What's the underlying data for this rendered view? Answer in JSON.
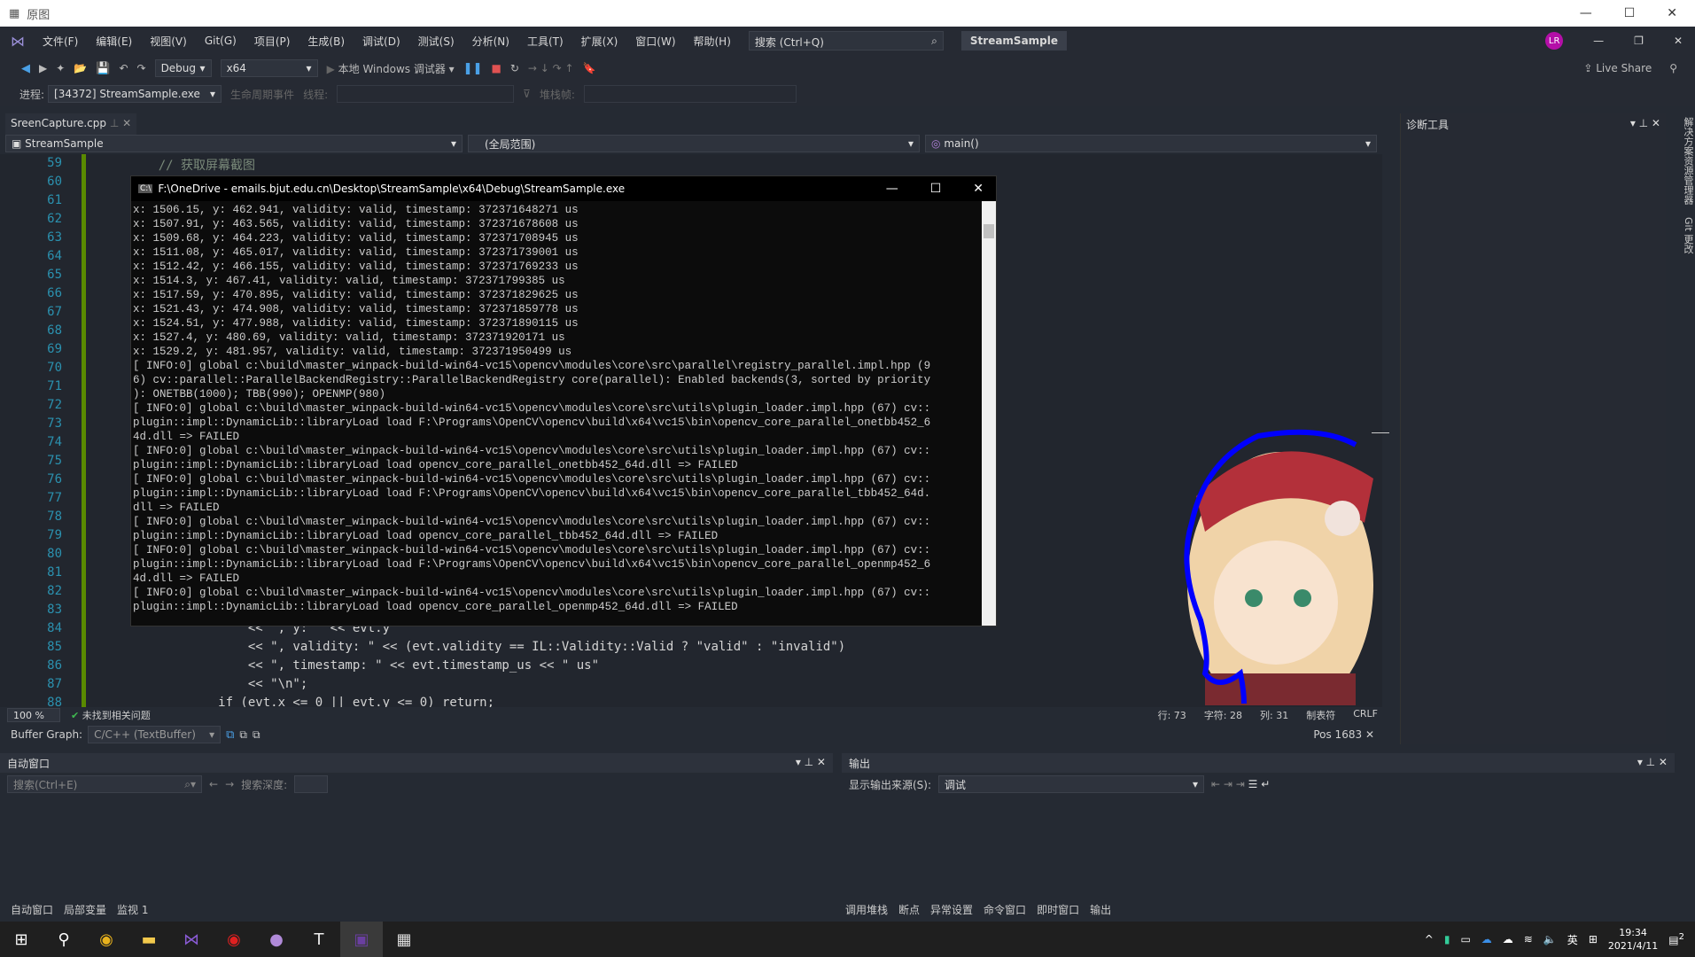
{
  "outer_window": {
    "title": "原图"
  },
  "menu": {
    "items": [
      "文件(F)",
      "编辑(E)",
      "视图(V)",
      "Git(G)",
      "项目(P)",
      "生成(B)",
      "调试(D)",
      "测试(S)",
      "分析(N)",
      "工具(T)",
      "扩展(X)",
      "窗口(W)",
      "帮助(H)"
    ],
    "search_placeholder": "搜索 (Ctrl+Q)",
    "solution": "StreamSample",
    "avatar": "LR"
  },
  "toolbar": {
    "config": "Debug",
    "platform": "x64",
    "debugger": "本地 Windows 调试器",
    "live_share": "Live Share"
  },
  "toolbar2": {
    "process_label": "进程:",
    "process": "[34372] StreamSample.exe",
    "lifecycle": "生命周期事件",
    "thread_label": "线程:",
    "stack_label": "堆栈帧:"
  },
  "editor": {
    "tab": "SreenCapture.cpp",
    "nav_project": "StreamSample",
    "nav_scope": "(全局范围)",
    "nav_func": "main()",
    "line_numbers": [
      "59",
      "60",
      "61",
      "62",
      "63",
      "64",
      "65",
      "66",
      "67",
      "68",
      "69",
      "70",
      "71",
      "72",
      "73",
      "74",
      "75",
      "76",
      "77",
      "78",
      "79",
      "80",
      "81",
      "82",
      "83",
      "84",
      "85",
      "86",
      "87",
      "88"
    ],
    "visible_code": {
      "59": "    // 获取屏幕截图",
      "84": "                << \", y: \" << evt.y",
      "85": "                << \", validity: \" << (evt.validity == IL::Validity::Valid ? \"valid\" : \"invalid\")",
      "86": "                << \", timestamp: \" << evt.timestamp_us << \" us\"",
      "87": "                << \"\\n\";",
      "88": "            if (evt.x <= 0 || evt.y <= 0) return;"
    },
    "zoom": "100 %",
    "issues": "未找到相关问题",
    "row": "行: 73",
    "char": "字符: 28",
    "col": "列: 31",
    "tabs": "制表符",
    "eol": "CRLF",
    "buffer_graph_label": "Buffer Graph:",
    "buffer_graph_value": "C/C++ (TextBuffer)",
    "pos": "Pos 1683"
  },
  "console": {
    "title": "F:\\OneDrive - emails.bjut.edu.cn\\Desktop\\StreamSample\\x64\\Debug\\StreamSample.exe",
    "lines": [
      "x: 1506.15, y: 462.941, validity: valid, timestamp: 372371648271 us",
      "x: 1507.91, y: 463.565, validity: valid, timestamp: 372371678608 us",
      "x: 1509.68, y: 464.223, validity: valid, timestamp: 372371708945 us",
      "x: 1511.08, y: 465.017, validity: valid, timestamp: 372371739001 us",
      "x: 1512.42, y: 466.155, validity: valid, timestamp: 372371769233 us",
      "x: 1514.3, y: 467.41, validity: valid, timestamp: 372371799385 us",
      "x: 1517.59, y: 470.895, validity: valid, timestamp: 372371829625 us",
      "x: 1521.43, y: 474.908, validity: valid, timestamp: 372371859778 us",
      "x: 1524.51, y: 477.988, validity: valid, timestamp: 372371890115 us",
      "x: 1527.4, y: 480.69, validity: valid, timestamp: 372371920171 us",
      "x: 1529.2, y: 481.957, validity: valid, timestamp: 372371950499 us",
      "[ INFO:0] global c:\\build\\master_winpack-build-win64-vc15\\opencv\\modules\\core\\src\\parallel\\registry_parallel.impl.hpp (9",
      "6) cv::parallel::ParallelBackendRegistry::ParallelBackendRegistry core(parallel): Enabled backends(3, sorted by priority",
      "): ONETBB(1000); TBB(990); OPENMP(980)",
      "[ INFO:0] global c:\\build\\master_winpack-build-win64-vc15\\opencv\\modules\\core\\src\\utils\\plugin_loader.impl.hpp (67) cv::",
      "plugin::impl::DynamicLib::libraryLoad load F:\\Programs\\OpenCV\\opencv\\build\\x64\\vc15\\bin\\opencv_core_parallel_onetbb452_6",
      "4d.dll => FAILED",
      "[ INFO:0] global c:\\build\\master_winpack-build-win64-vc15\\opencv\\modules\\core\\src\\utils\\plugin_loader.impl.hpp (67) cv::",
      "plugin::impl::DynamicLib::libraryLoad load opencv_core_parallel_onetbb452_64d.dll => FAILED",
      "[ INFO:0] global c:\\build\\master_winpack-build-win64-vc15\\opencv\\modules\\core\\src\\utils\\plugin_loader.impl.hpp (67) cv::",
      "plugin::impl::DynamicLib::libraryLoad load F:\\Programs\\OpenCV\\opencv\\build\\x64\\vc15\\bin\\opencv_core_parallel_tbb452_64d.",
      "dll => FAILED",
      "[ INFO:0] global c:\\build\\master_winpack-build-win64-vc15\\opencv\\modules\\core\\src\\utils\\plugin_loader.impl.hpp (67) cv::",
      "plugin::impl::DynamicLib::libraryLoad load opencv_core_parallel_tbb452_64d.dll => FAILED",
      "[ INFO:0] global c:\\build\\master_winpack-build-win64-vc15\\opencv\\modules\\core\\src\\utils\\plugin_loader.impl.hpp (67) cv::",
      "plugin::impl::DynamicLib::libraryLoad load F:\\Programs\\OpenCV\\opencv\\build\\x64\\vc15\\bin\\opencv_core_parallel_openmp452_6",
      "4d.dll => FAILED",
      "[ INFO:0] global c:\\build\\master_winpack-build-win64-vc15\\opencv\\modules\\core\\src\\utils\\plugin_loader.impl.hpp (67) cv::",
      "plugin::impl::DynamicLib::libraryLoad load opencv_core_parallel_openmp452_64d.dll => FAILED"
    ]
  },
  "diagnostics": {
    "title": "诊断工具"
  },
  "side_strip": [
    "解决方案资源管理器",
    "Git 更改"
  ],
  "auto_panel": {
    "title": "自动窗口",
    "search_placeholder": "搜索(Ctrl+E)",
    "depth_label": "搜索深度:",
    "tabs": [
      "自动窗口",
      "局部变量",
      "监视 1"
    ]
  },
  "output_panel": {
    "title": "输出",
    "source_label": "显示输出来源(S):",
    "source": "调试",
    "tabs": [
      "调用堆栈",
      "断点",
      "异常设置",
      "命令窗口",
      "即时窗口",
      "输出"
    ]
  },
  "taskbar": {
    "time": "19:34",
    "date": "2021/4/11",
    "ime": "英",
    "notifications": "2"
  },
  "colors": {
    "accent": "#b40fa8",
    "stroke": "#0000ff"
  }
}
